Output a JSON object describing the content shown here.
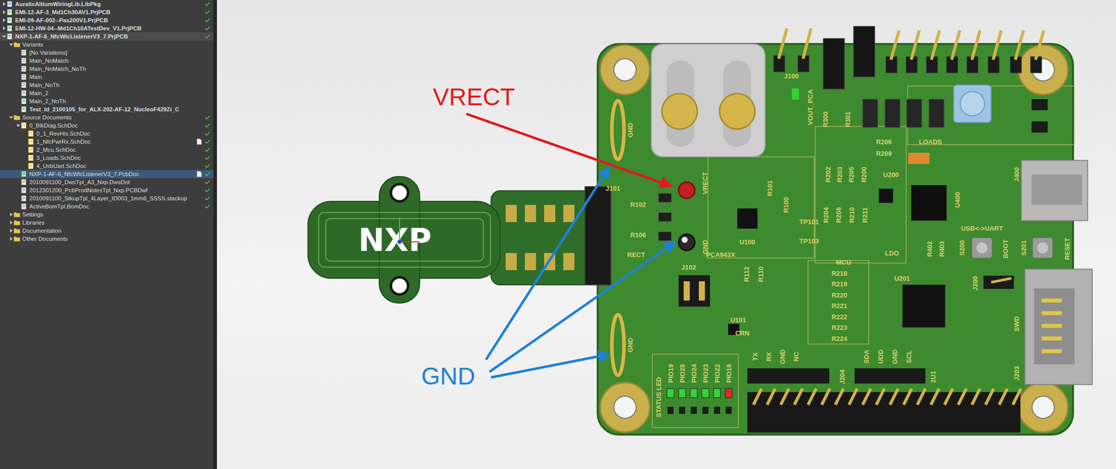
{
  "tree": [
    {
      "label": "AuralixAltiumWiringLib.LibPkg",
      "level": 0,
      "kind": "library",
      "bold": true,
      "expandable": true,
      "expanded": false,
      "checked": true,
      "modified": false,
      "selected": false,
      "active": false
    },
    {
      "label": "EMI-12-AF-3_Md1Ch30AV1.PrjPCB",
      "level": 0,
      "kind": "project",
      "bold": true,
      "expandable": true,
      "expanded": false,
      "checked": true,
      "modified": false,
      "selected": false,
      "active": false
    },
    {
      "label": "EMI-09-AF-002--Pas200V1.PrjPCB",
      "level": 0,
      "kind": "project",
      "bold": true,
      "expandable": true,
      "expanded": false,
      "checked": true,
      "modified": false,
      "selected": false,
      "active": false
    },
    {
      "label": "EMI-12-HW-04--Md1Ch10ATestDev_V1.PrjPCB",
      "level": 0,
      "kind": "project",
      "bold": true,
      "expandable": true,
      "expanded": false,
      "checked": true,
      "modified": false,
      "selected": false,
      "active": false
    },
    {
      "label": "NXP-1-AF-6_NfcWlcListenerV3_7.PrjPCB",
      "level": 0,
      "kind": "project",
      "bold": true,
      "expandable": true,
      "expanded": true,
      "checked": true,
      "modified": false,
      "selected": false,
      "active": true
    },
    {
      "label": "Variants",
      "level": 1,
      "kind": "folder",
      "bold": false,
      "expandable": true,
      "expanded": true,
      "checked": false,
      "modified": false,
      "selected": false,
      "active": false
    },
    {
      "label": "[No Variations]",
      "level": 2,
      "kind": "variant",
      "bold": false,
      "expandable": false,
      "expanded": false,
      "checked": false,
      "modified": false,
      "selected": false,
      "active": false
    },
    {
      "label": "Main_NoMatch",
      "level": 2,
      "kind": "variant",
      "bold": false,
      "expandable": false,
      "expanded": false,
      "checked": false,
      "modified": false,
      "selected": false,
      "active": false
    },
    {
      "label": "Main_NoMatch_NoTh",
      "level": 2,
      "kind": "variant",
      "bold": false,
      "expandable": false,
      "expanded": false,
      "checked": false,
      "modified": false,
      "selected": false,
      "active": false
    },
    {
      "label": "Main",
      "level": 2,
      "kind": "variant",
      "bold": false,
      "expandable": false,
      "expanded": false,
      "checked": false,
      "modified": false,
      "selected": false,
      "active": false
    },
    {
      "label": "Main_NoTh",
      "level": 2,
      "kind": "variant",
      "bold": false,
      "expandable": false,
      "expanded": false,
      "checked": false,
      "modified": false,
      "selected": false,
      "active": false
    },
    {
      "label": "Main_2",
      "level": 2,
      "kind": "variant",
      "bold": false,
      "expandable": false,
      "expanded": false,
      "checked": false,
      "modified": false,
      "selected": false,
      "active": false
    },
    {
      "label": "Main_2_NoTh",
      "level": 2,
      "kind": "variant",
      "bold": false,
      "expandable": false,
      "expanded": false,
      "checked": false,
      "modified": false,
      "selected": false,
      "active": false
    },
    {
      "label": "Test_Id_2100105_for_ALX-202-AF-12_NucleoF429Zi_C",
      "level": 2,
      "kind": "variant",
      "bold": true,
      "expandable": false,
      "expanded": false,
      "checked": false,
      "modified": false,
      "selected": false,
      "active": false
    },
    {
      "label": "Source Documents",
      "level": 1,
      "kind": "folder",
      "bold": false,
      "expandable": true,
      "expanded": true,
      "checked": true,
      "modified": false,
      "selected": false,
      "active": false
    },
    {
      "label": "0_BlkDiag.SchDoc",
      "level": 2,
      "kind": "schematic",
      "bold": false,
      "expandable": true,
      "expanded": true,
      "checked": true,
      "modified": false,
      "selected": false,
      "active": false
    },
    {
      "label": "0_1_RevHis.SchDoc",
      "level": 3,
      "kind": "schematic",
      "bold": false,
      "expandable": false,
      "expanded": false,
      "checked": true,
      "modified": false,
      "selected": false,
      "active": false
    },
    {
      "label": "1_NfcPwrRx.SchDoc",
      "level": 3,
      "kind": "schematic",
      "bold": false,
      "expandable": false,
      "expanded": false,
      "checked": true,
      "modified": true,
      "selected": false,
      "active": false
    },
    {
      "label": "2_Mcu.SchDoc",
      "level": 3,
      "kind": "schematic",
      "bold": false,
      "expandable": false,
      "expanded": false,
      "checked": true,
      "modified": false,
      "selected": false,
      "active": false
    },
    {
      "label": "3_Loads.SchDoc",
      "level": 3,
      "kind": "schematic",
      "bold": false,
      "expandable": false,
      "expanded": false,
      "checked": true,
      "modified": false,
      "selected": false,
      "active": false
    },
    {
      "label": "4_UsbUart.SchDoc",
      "level": 3,
      "kind": "schematic",
      "bold": false,
      "expandable": false,
      "expanded": false,
      "checked": true,
      "modified": false,
      "selected": false,
      "active": false
    },
    {
      "label": "NXP-1-AF-6_NfcWlcListenerV3_7.PcbDoc",
      "level": 2,
      "kind": "pcb",
      "bold": false,
      "expandable": false,
      "expanded": false,
      "checked": true,
      "modified": true,
      "selected": true,
      "active": false
    },
    {
      "label": "2010091100_DwsTpl_A3_Nxp.DwsDot",
      "level": 2,
      "kind": "file",
      "bold": false,
      "expandable": false,
      "expanded": false,
      "checked": true,
      "modified": false,
      "selected": false,
      "active": false
    },
    {
      "label": "2012301200_PcbProdNotesTpl_Nxp.PCBDwf",
      "level": 2,
      "kind": "file",
      "bold": false,
      "expandable": false,
      "expanded": false,
      "checked": true,
      "modified": false,
      "selected": false,
      "active": false
    },
    {
      "label": "2010091100_StkupTpl_4Layer_ID003_1mm6_SSSS.stackup",
      "level": 2,
      "kind": "file",
      "bold": false,
      "expandable": false,
      "expanded": false,
      "checked": true,
      "modified": false,
      "selected": false,
      "active": false
    },
    {
      "label": "ActiveBomTpl.BomDoc",
      "level": 2,
      "kind": "file",
      "bold": false,
      "expandable": false,
      "expanded": false,
      "checked": true,
      "modified": false,
      "selected": false,
      "active": false
    },
    {
      "label": "Settings",
      "level": 1,
      "kind": "folder",
      "bold": false,
      "expandable": true,
      "expanded": false,
      "checked": false,
      "modified": false,
      "selected": false,
      "active": false
    },
    {
      "label": "Libraries",
      "level": 1,
      "kind": "folder",
      "bold": false,
      "expandable": true,
      "expanded": false,
      "checked": false,
      "modified": false,
      "selected": false,
      "active": false
    },
    {
      "label": "Documentation",
      "level": 1,
      "kind": "folder",
      "bold": false,
      "expandable": true,
      "expanded": false,
      "checked": false,
      "modified": false,
      "selected": false,
      "active": false
    },
    {
      "label": "Other Documents",
      "level": 1,
      "kind": "folder",
      "bold": false,
      "expandable": true,
      "expanded": false,
      "checked": false,
      "modified": false,
      "selected": false,
      "active": false
    }
  ],
  "pcb": {
    "logo": "NXP",
    "labels": [
      "J100",
      "VOUT_PCA",
      "R300",
      "R301",
      "R206",
      "R209",
      "R202",
      "R203",
      "R205",
      "R200",
      "U200",
      "LOADS",
      "J400",
      "R101",
      "R100",
      "TP101",
      "TP103",
      "U100",
      "PCA943X",
      "R102",
      "R106",
      "J101",
      "RECT",
      "VRECT",
      "GND",
      "J102",
      "R112",
      "R110",
      "U101",
      "CRN",
      "MCU",
      "LDO",
      "USB<->UART",
      "U400",
      "R204",
      "R208",
      "R210",
      "R211",
      "R402",
      "R403",
      "S200",
      "BOOT",
      "S201",
      "RESET",
      "U201",
      "J200",
      "SWD",
      "J203",
      "STATUS LED",
      "J204",
      "2U1",
      "GND",
      "GND"
    ],
    "resistor_column": [
      "R218",
      "R219",
      "R220",
      "R221",
      "R222",
      "R223",
      "R224"
    ],
    "status_leds": [
      {
        "label": "PIO19",
        "color": "#36d23a"
      },
      {
        "label": "PIO25",
        "color": "#36d23a"
      },
      {
        "label": "PIO24",
        "color": "#36d23a"
      },
      {
        "label": "PIO23",
        "color": "#36d23a"
      },
      {
        "label": "PIO22",
        "color": "#36d23a"
      },
      {
        "label": "PIO18",
        "color": "#e02a2a"
      }
    ],
    "uart_pins": [
      "TX",
      "RX",
      "GND",
      "NC"
    ],
    "i2c_pins": [
      "SDA",
      "UDD",
      "GND",
      "SCL"
    ]
  },
  "annotations": [
    {
      "label": "VRECT",
      "color": "#e01b1b",
      "targets": 1
    },
    {
      "label": "GND",
      "color": "#1f80d8",
      "targets": 3
    }
  ]
}
